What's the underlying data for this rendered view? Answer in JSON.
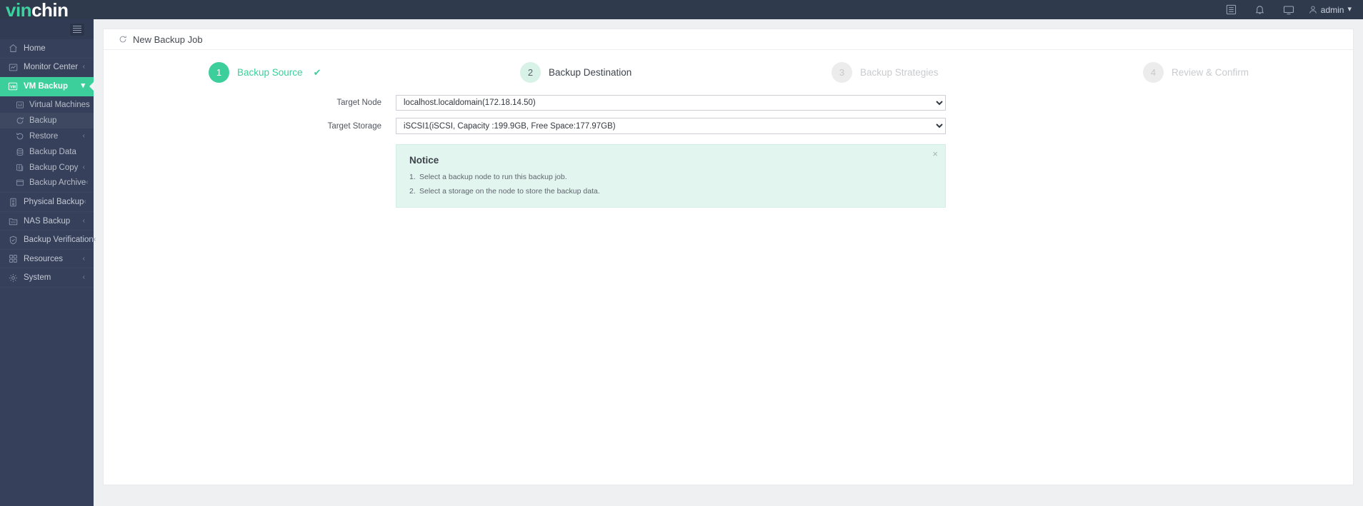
{
  "topbar": {
    "logo_vin": "vin",
    "logo_chin": "chin",
    "icons": [
      {
        "name": "list-icon"
      },
      {
        "name": "bell-icon"
      },
      {
        "name": "monitor-icon"
      }
    ],
    "user": {
      "icon": "user-icon",
      "label": "admin",
      "chevron": "⌄"
    }
  },
  "sidebar": {
    "hamburger": "menu-icon",
    "items": [
      {
        "label": "Home",
        "icon": "home-icon",
        "chevron": "",
        "state": "normal"
      },
      {
        "label": "Monitor Center",
        "icon": "monitor-center-icon",
        "chevron": "‹",
        "state": "normal"
      },
      {
        "label": "VM Backup",
        "icon": "vm-icon",
        "chevron": "⌄",
        "state": "active"
      }
    ],
    "sub_items": [
      {
        "label": "Virtual Machines",
        "icon": "virtual-machines-icon",
        "chevron": "",
        "selected": false
      },
      {
        "label": "Backup",
        "icon": "backup-icon",
        "chevron": "",
        "selected": true
      },
      {
        "label": "Restore",
        "icon": "restore-icon",
        "chevron": "‹",
        "selected": false
      },
      {
        "label": "Backup Data",
        "icon": "database-icon",
        "chevron": "",
        "selected": false
      },
      {
        "label": "Backup Copy",
        "icon": "copy-icon",
        "chevron": "‹",
        "selected": false
      },
      {
        "label": "Backup Archive",
        "icon": "archive-icon",
        "chevron": "‹",
        "selected": false
      }
    ],
    "items_after": [
      {
        "label": "Physical Backup",
        "icon": "server-icon",
        "chevron": "‹",
        "state": "normal"
      },
      {
        "label": "NAS Backup",
        "icon": "nas-folder-icon",
        "chevron": "‹",
        "state": "normal"
      },
      {
        "label": "Backup Verification",
        "icon": "shield-check-icon",
        "chevron": "‹",
        "state": "normal"
      },
      {
        "label": "Resources",
        "icon": "grid-icon",
        "chevron": "‹",
        "state": "normal"
      },
      {
        "label": "System",
        "icon": "gear-icon",
        "chevron": "‹",
        "state": "normal"
      }
    ]
  },
  "page": {
    "title": "New Backup Job",
    "refresh_icon": "refresh-icon"
  },
  "stepper": {
    "steps": [
      {
        "number": "1",
        "label": "Backup Source",
        "state": "done",
        "check": "✔"
      },
      {
        "number": "2",
        "label": "Backup Destination",
        "state": "current",
        "check": ""
      },
      {
        "number": "3",
        "label": "Backup Strategies",
        "state": "todo",
        "check": ""
      },
      {
        "number": "4",
        "label": "Review & Confirm",
        "state": "todo",
        "check": ""
      }
    ]
  },
  "form": {
    "target_node": {
      "label": "Target Node",
      "value": "localhost.localdomain(172.18.14.50)",
      "options": [
        "localhost.localdomain(172.18.14.50)"
      ]
    },
    "target_storage": {
      "label": "Target Storage",
      "value": "iSCSI1(iSCSI, Capacity :199.9GB, Free Space:177.97GB)",
      "options": [
        "iSCSI1(iSCSI, Capacity :199.9GB, Free Space:177.97GB)"
      ]
    }
  },
  "notice": {
    "title": "Notice",
    "close": "×",
    "items": [
      {
        "num": "1.",
        "text": "Select a backup node to run this backup job."
      },
      {
        "num": "2.",
        "text": "Select a storage on the node to store the backup data."
      }
    ]
  },
  "colors": {
    "brand_green": "#3ccf9b",
    "sidebar_bg": "#36405a",
    "topbar_bg": "#2f3a4d",
    "notice_bg": "#e2f5ee"
  }
}
